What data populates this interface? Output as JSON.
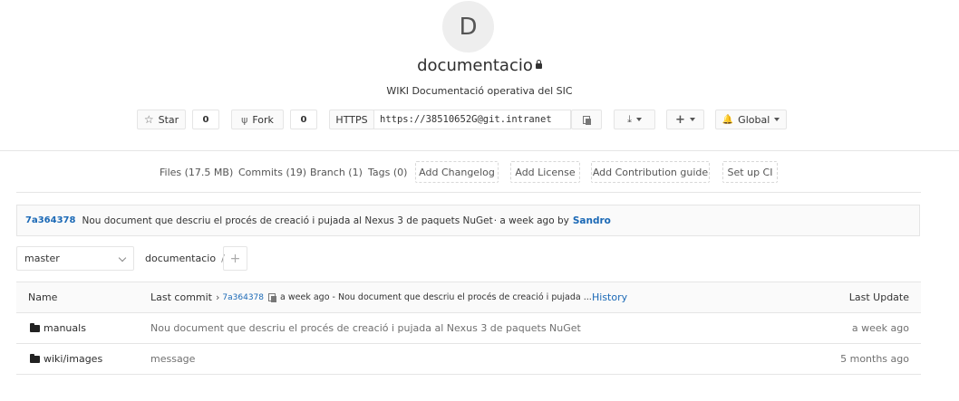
{
  "project": {
    "avatar_letter": "D",
    "name": "documentacio",
    "description": "WIKI Documentació operativa del SIC"
  },
  "actions": {
    "star_label": "Star",
    "star_count": "0",
    "fork_label": "Fork",
    "fork_count": "0",
    "protocol": "HTTPS",
    "clone_url": "https://38510652G@git.intranet",
    "notification_label": "Global"
  },
  "stats": {
    "files": "Files (17.5 MB)",
    "commits": "Commits (19)",
    "branch": "Branch (1)",
    "tags": "Tags (0)",
    "add_changelog": "Add Changelog",
    "add_license": "Add License",
    "add_contribution": "Add Contribution guide",
    "setup_ci": "Set up CI"
  },
  "last_commit_bar": {
    "sha": "7a364378",
    "message": "Nou document que descriu el procés de creació i pujada al Nexus 3 de paquets NuGet",
    "meta": " · a week ago by",
    "author": "Sandro"
  },
  "tree_nav": {
    "branch": "master",
    "path": "documentacio",
    "separator": "/",
    "add": "+"
  },
  "table": {
    "col_name": "Name",
    "col_last_commit": "Last commit",
    "header_sha": "7a364378",
    "header_commit_text": "a week ago - Nou document que descriu el procés de creació i pujada ...",
    "history": "History",
    "col_last_update": "Last Update",
    "rows": [
      {
        "name": "manuals",
        "commit": "Nou document que descriu el procés de creació i pujada al Nexus 3 de paquets NuGet",
        "updated": "a week ago"
      },
      {
        "name": "wiki/images",
        "commit": "message",
        "updated": "5 months ago"
      }
    ]
  }
}
